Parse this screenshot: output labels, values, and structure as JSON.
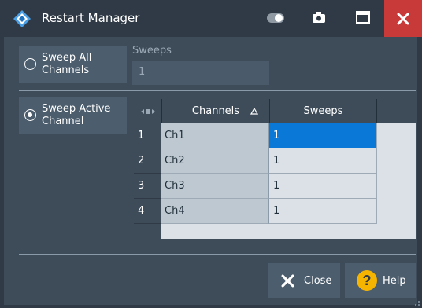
{
  "window": {
    "title": "Restart Manager"
  },
  "options": {
    "sweep_all": {
      "label_line1": "Sweep All",
      "label_line2": "Channels",
      "selected": false
    },
    "sweep_active": {
      "label_line1": "Sweep Active",
      "label_line2": "Channel",
      "selected": true
    }
  },
  "sweeps_field": {
    "label": "Sweeps",
    "value": "1"
  },
  "table": {
    "corner_icon": "column-resize-icon",
    "columns": [
      {
        "label": "Channels",
        "sort": "ascending"
      },
      {
        "label": "Sweeps"
      }
    ],
    "rows": [
      {
        "index": "1",
        "channel": "Ch1",
        "sweeps": "1",
        "selected": true
      },
      {
        "index": "2",
        "channel": "Ch2",
        "sweeps": "1"
      },
      {
        "index": "3",
        "channel": "Ch3",
        "sweeps": "1"
      },
      {
        "index": "4",
        "channel": "Ch4",
        "sweeps": "1"
      }
    ]
  },
  "buttons": {
    "close": {
      "label": "Close",
      "icon": "x-icon"
    },
    "help": {
      "label": "Help",
      "icon": "question-icon"
    }
  },
  "colors": {
    "background": "#2f3a46",
    "panel": "#3e4c5a",
    "close_accent": "#c83a3a",
    "selection": "#0a78d7",
    "help_icon": "#f5b400"
  }
}
